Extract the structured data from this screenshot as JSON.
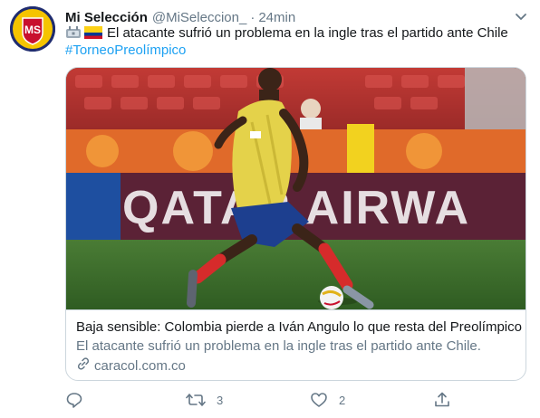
{
  "author": {
    "name": "Mi Selección",
    "handle": "@MiSeleccion_",
    "separator": "·",
    "time": "24min",
    "avatar_text": "MS"
  },
  "tweet": {
    "text": "El atacante sufrió un problema en la ingle tras el partido ante Chile",
    "hashtag": "#TorneoPreolímpico",
    "emoji_icons": [
      "stadium-icon",
      "colombia-flag-icon"
    ]
  },
  "card": {
    "image_alt_icon": "soccer-player-photo",
    "image_banner_text": "QATAR AIRWA",
    "title": "Baja sensible: Colombia pierde a Iván Angulo lo que resta del Preolímpico",
    "description": "El atacante sufrió un problema en la ingle tras el partido ante Chile.",
    "domain": "caracol.com.co"
  },
  "actions": {
    "reply": {
      "icon": "reply-icon",
      "count": ""
    },
    "retweet": {
      "icon": "retweet-icon",
      "count": "3"
    },
    "like": {
      "icon": "heart-icon",
      "count": "2"
    },
    "share": {
      "icon": "share-icon",
      "count": ""
    }
  },
  "colors": {
    "link": "#1da1f2",
    "secondary_text": "#657786",
    "border": "#ccd6dd",
    "primary_text": "#14171a"
  }
}
